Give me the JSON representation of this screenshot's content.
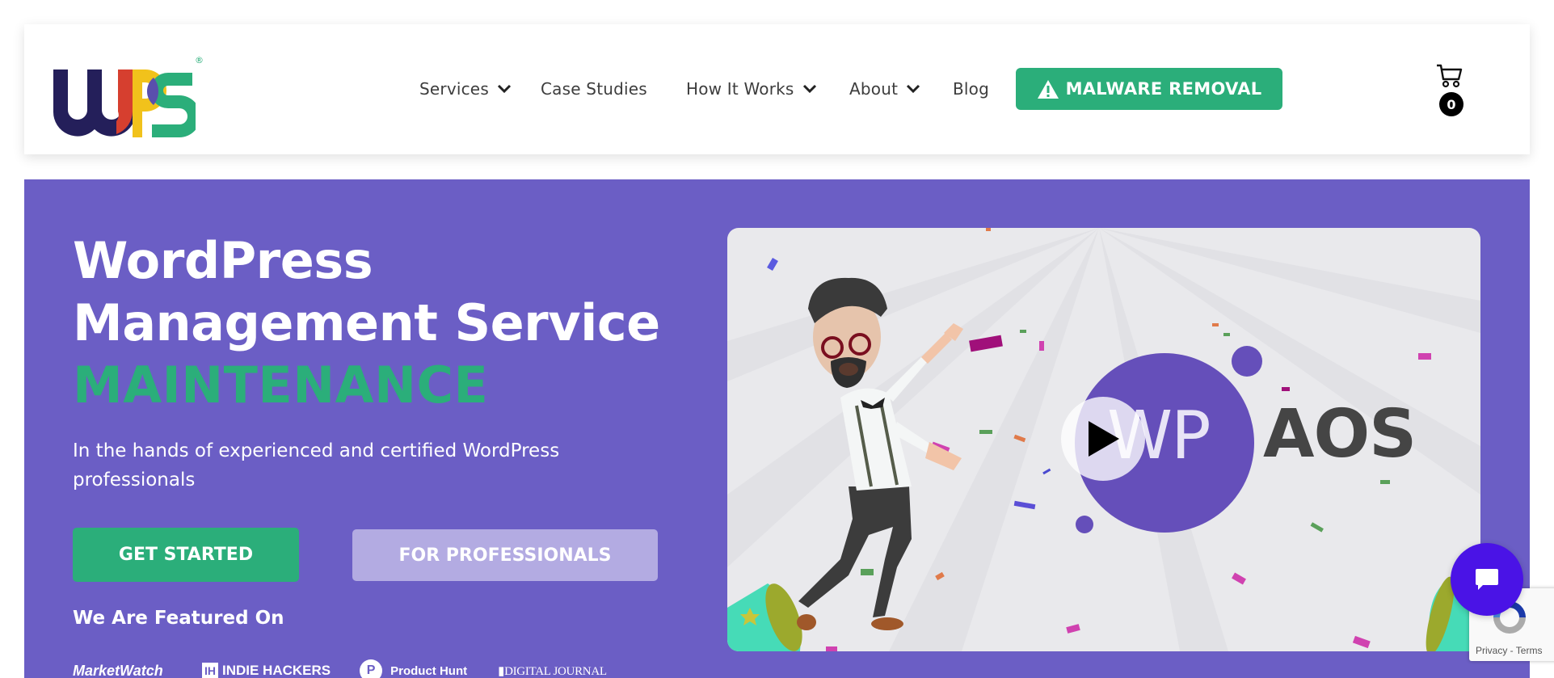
{
  "header": {
    "logo": {
      "letters": [
        "W",
        "P",
        "S"
      ],
      "registered_mark": "®",
      "alt": "WPS logo"
    },
    "nav": [
      {
        "label": "Services",
        "has_dropdown": true
      },
      {
        "label": "Case Studies",
        "has_dropdown": false
      },
      {
        "label": "How It Works",
        "has_dropdown": true
      },
      {
        "label": "About",
        "has_dropdown": true
      },
      {
        "label": "Blog",
        "has_dropdown": false
      }
    ],
    "cta": {
      "label": "MALWARE REMOVAL",
      "icon": "warning-icon"
    },
    "cart": {
      "icon": "cart-icon",
      "count": "0"
    }
  },
  "hero": {
    "title_line1": "WordPress",
    "title_line2": "Management Service",
    "title_accent": "MAINTENANCE",
    "subtitle": "In the hands of experienced and certified WordPress professionals",
    "primary_button": "GET STARTED",
    "secondary_button": "FOR PROFESSIONALS",
    "featured_heading": "We Are Featured On",
    "featured_logos": {
      "marketwatch": "MarketWatch",
      "indiehackers_box": "IH",
      "indiehackers": "INDIE HACKERS",
      "producthunt_mark": "P",
      "producthunt": "Product Hunt",
      "digitaljournal": "▮DIGITAL JOURNAL"
    }
  },
  "video": {
    "brand_left": "WP",
    "brand_right": "AOS",
    "play_icon": "play-icon"
  },
  "widgets": {
    "chat_icon": "chat-bubble-icon",
    "recaptcha_privacy": "Privacy",
    "recaptcha_separator": " - ",
    "recaptcha_terms": "Terms"
  },
  "colors": {
    "brand_green": "#2bae7a",
    "hero_purple": "#6b5ec5",
    "secondary_button": "#b3abe2",
    "chat_purple": "#4a13e6",
    "logo_navy": "#241f5a",
    "logo_red": "#d63f2f",
    "logo_yellow": "#f1c21b"
  }
}
